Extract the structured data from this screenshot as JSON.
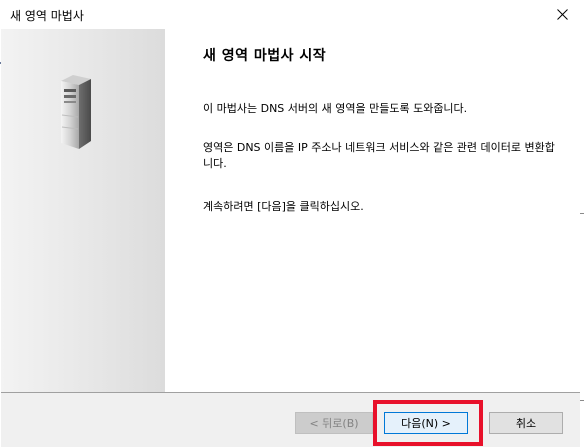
{
  "window": {
    "title": "새 영역 마법사"
  },
  "wizard": {
    "heading": "새 영역 마법사 시작",
    "paragraphs": [
      "이 마법사는 DNS 서버의 새 영역을 만들도록 도와줍니다.",
      "영역은 DNS 이름을 IP 주소나 네트워크 서비스와 같은 관련 데이터로 변환합니다.",
      "계속하려면 [다음]을 클릭하십시오."
    ]
  },
  "buttons": {
    "back": "< 뒤로(B)",
    "next": "다음(N) >",
    "cancel": "취소"
  },
  "state": {
    "back_enabled": false,
    "highlighted_button": "next"
  },
  "icons": {
    "close": "close-icon",
    "sidebar": "server-icon"
  },
  "colors": {
    "highlight": "#e8102a",
    "default_button_border": "#0078d7"
  }
}
